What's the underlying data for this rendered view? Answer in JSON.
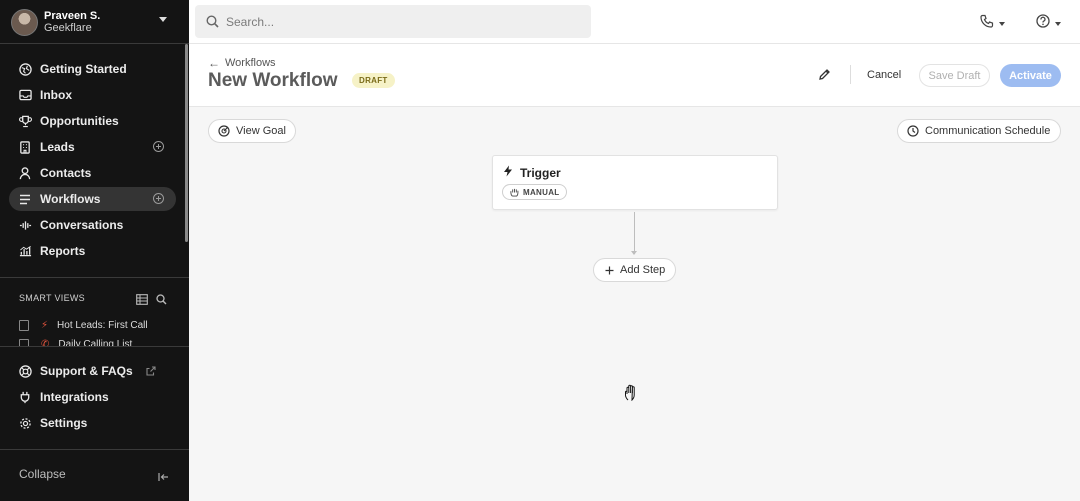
{
  "user": {
    "name": "Praveen S.",
    "org": "Geekflare"
  },
  "nav": {
    "items": [
      {
        "label": "Getting Started",
        "icon": "globe-icon"
      },
      {
        "label": "Inbox",
        "icon": "inbox-icon"
      },
      {
        "label": "Opportunities",
        "icon": "trophy-icon"
      },
      {
        "label": "Leads",
        "icon": "building-icon"
      },
      {
        "label": "Contacts",
        "icon": "person-icon"
      },
      {
        "label": "Workflows",
        "icon": "list-icon"
      },
      {
        "label": "Conversations",
        "icon": "waveform-icon"
      },
      {
        "label": "Reports",
        "icon": "chart-icon"
      }
    ],
    "active": "Workflows"
  },
  "smart_views": {
    "title": "SMART VIEWS",
    "items": [
      "Hot Leads: First Call",
      "Daily Calling List"
    ]
  },
  "footer_nav": {
    "items": [
      {
        "label": "Support & FAQs",
        "icon": "lifebuoy-icon"
      },
      {
        "label": "Integrations",
        "icon": "plug-icon"
      },
      {
        "label": "Settings",
        "icon": "gear-icon"
      }
    ],
    "collapse": "Collapse"
  },
  "search": {
    "placeholder": "Search..."
  },
  "header": {
    "breadcrumb": "Workflows",
    "title": "New Workflow",
    "status": "DRAFT",
    "cancel": "Cancel",
    "save_draft": "Save Draft",
    "activate": "Activate"
  },
  "canvas": {
    "view_goal": "View Goal",
    "communication_schedule": "Communication Schedule",
    "trigger_title": "Trigger",
    "trigger_type": "MANUAL",
    "add_step": "Add Step"
  },
  "colors": {
    "sidebar_bg": "#141414",
    "activate_bg": "#9dbcf1",
    "draft_badge_bg": "#f6f2c7",
    "smart_view_icon": "#e0533d"
  }
}
